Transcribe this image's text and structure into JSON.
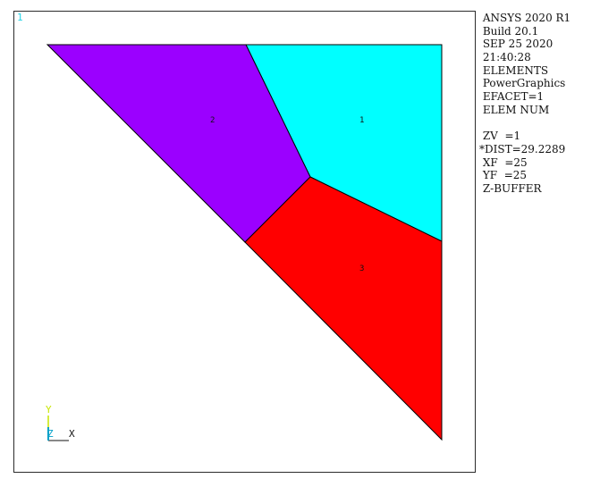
{
  "window": {
    "number": "1"
  },
  "info_panel": {
    "lines": [
      " ANSYS 2020 R1",
      " Build 20.1",
      " SEP 25 2020",
      " 21:40:28",
      " ELEMENTS",
      " PowerGraphics",
      " EFACET=1",
      " ELEM NUM",
      "",
      " ZV  =1",
      "*DIST=29.2289",
      " XF  =25",
      " YF  =25",
      " Z-BUFFER"
    ]
  },
  "elements": [
    {
      "number": "1",
      "color": "#00ffff"
    },
    {
      "number": "2",
      "color": "#9b00ff"
    },
    {
      "number": "3",
      "color": "#ff0000"
    }
  ],
  "triad": {
    "x_label": "X",
    "y_label": "Y",
    "z_label": "Z",
    "x_color": "#111111",
    "y_color": "#c8e600",
    "z_color": "#00a0c8"
  },
  "colors": {
    "edge": "#000000",
    "background": "#ffffff"
  }
}
